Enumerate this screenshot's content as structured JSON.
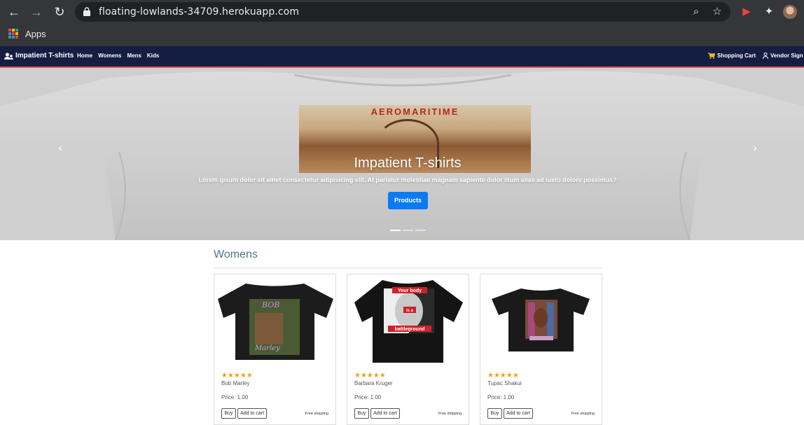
{
  "browser": {
    "url": "floating-lowlands-34709.herokuapp.com",
    "bookmarks": {
      "apps_label": "Apps"
    },
    "icons": [
      "back-icon",
      "forward-icon",
      "reload-icon",
      "lock-icon",
      "zoom-icon",
      "star-icon",
      "extension-media-icon",
      "puzzle-icon",
      "profile-avatar"
    ]
  },
  "navbar": {
    "brand": "Impatient T-shirts",
    "links": [
      "Home",
      "Womens",
      "Mens",
      "Kids"
    ],
    "cart": "Shopping Cart",
    "vendor": "Vendor Sign In"
  },
  "carousel": {
    "poster_title": "AEROMARITIME",
    "title": "Impatient T-shirts",
    "text": "Lorem ipsum dolor sit amet consectetur adipisicing elit. At pariatur molestiae magnam sapiente dolor illum alias ad iusto dolore possimus?",
    "button": "Products",
    "prev": "‹",
    "next": "›",
    "slides": 3,
    "active_slide": 1
  },
  "section": {
    "title": "Womens",
    "products": [
      {
        "name": "Bob Marley",
        "price": "Price: 1.00",
        "rating": 5,
        "stars": "★★★★★",
        "buy": "Buy",
        "add": "Add to cart",
        "shipping": "Free shipping"
      },
      {
        "name": "Barbara Kruger",
        "price": "Price: 1.00",
        "rating": 5,
        "stars": "★★★★★",
        "buy": "Buy",
        "add": "Add to cart",
        "shipping": "Free shipping",
        "shirt_print": {
          "top": "Your body",
          "middle": "is a",
          "bottom": "battleground"
        }
      },
      {
        "name": "Tupac Shakur",
        "price": "Price: 1.00",
        "rating": 5,
        "stars": "★★★★★",
        "buy": "Buy",
        "add": "Add to cart",
        "shipping": "Free shipping"
      }
    ]
  },
  "colors": {
    "navbar_bg": "#141e41",
    "navbar_border": "#e0535b",
    "primary_button": "#0a7bf2",
    "star": "#f1a10d",
    "section_title": "#4a7a8a"
  }
}
